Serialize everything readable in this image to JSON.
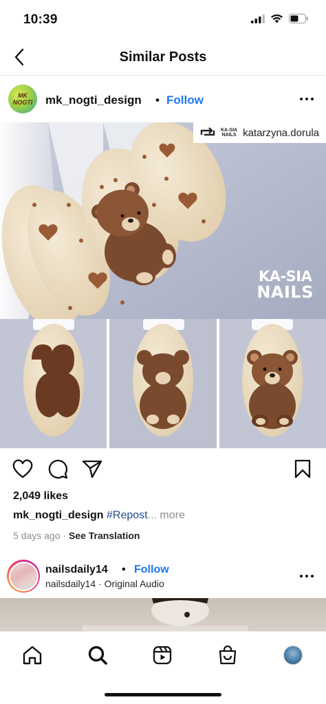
{
  "status_bar": {
    "time": "10:39"
  },
  "header": {
    "title": "Similar Posts"
  },
  "post": {
    "username": "mk_nogti_design",
    "separator": "•",
    "follow_label": "Follow",
    "avatar_text_1": "MK",
    "avatar_text_2": "NOGTI",
    "repost": {
      "username": "katarzyna.dorula",
      "logo_line1": "KA-SIA",
      "logo_line2": "NAILS"
    },
    "watermark": {
      "line1": "KA-SIA",
      "line2": "NAILS"
    },
    "likes": "2,049 likes",
    "caption": {
      "username": "mk_nogti_design",
      "hashtag": "#Repost",
      "more": "... more"
    },
    "time_ago": "5 days ago",
    "meta_separator": "·",
    "translate_label": "See Translation"
  },
  "next_post": {
    "username": "nailsdaily14",
    "separator": "•",
    "follow_label": "Follow",
    "subtitle": "nailsdaily14 · Original Audio"
  },
  "icons": {
    "back": "chevron-left-icon",
    "more": "more-horizontal-icon",
    "like": "heart-icon",
    "comment": "comment-icon",
    "share": "send-icon",
    "save": "bookmark-icon",
    "repost": "repost-icon",
    "home": "home-icon",
    "search": "search-icon",
    "reels": "reels-icon",
    "shop": "shop-icon",
    "profile": "profile-avatar"
  },
  "colors": {
    "accent": "#1a77f2",
    "hashtag": "#244c8a",
    "muted": "#8e8e8e",
    "nail_base": "#eadcc2",
    "bear_brown": "#7a4a2e"
  }
}
